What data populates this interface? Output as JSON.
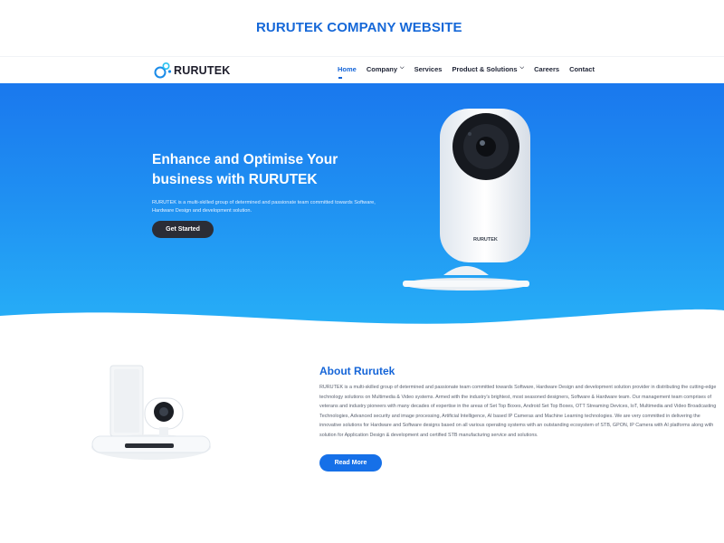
{
  "page_caption": "RURUTEK COMPANY WEBSITE",
  "brand": {
    "name": "RURUTEK",
    "accent": "#1565d8"
  },
  "nav": {
    "items": [
      {
        "label": "Home",
        "active": true,
        "dropdown": false
      },
      {
        "label": "Company",
        "active": false,
        "dropdown": true
      },
      {
        "label": "Services",
        "active": false,
        "dropdown": false
      },
      {
        "label": "Product & Solutions",
        "active": false,
        "dropdown": true
      },
      {
        "label": "Careers",
        "active": false,
        "dropdown": false
      },
      {
        "label": "Contact",
        "active": false,
        "dropdown": false
      }
    ]
  },
  "hero": {
    "title": "Enhance and Optimise Your business with RURUTEK",
    "description": "RURUTEK is a multi-skilled group of determined and passionate team committed towards Software, Hardware Design and development solution.",
    "cta_label": "Get Started",
    "device_label": "RURUTEK"
  },
  "about": {
    "title": "About Rurutek",
    "description": "RURUTEK is a multi-skilled group of determined and passionate team committed towards Software, Hardware Design and development solution provider in distributing the cutting-edge technology solutions on Multimedia & Video systems. Armed with the industry's brightest, most seasoned designers, Software & Hardware team. Our management team comprises of veterans and industry pioneers with many decades of expertise in the areas of Set Top Boxes, Android Set Top Boxes, OTT Streaming Devices, IoT, Multimedia and Video Broadcasting Technologies, Advanced security and image processing, Artificial Intelligence, AI based IP Cameras and Machine Learning technologies. We are very committed in delivering the innovative solutions for Hardware and Software designs based on all various operating systems with an outstanding ecosystem of STB, GPON, IP Camera with AI platforms along with solution for Application Design & development and certified STB manufacturing service and solutions.",
    "cta_label": "Read More"
  }
}
